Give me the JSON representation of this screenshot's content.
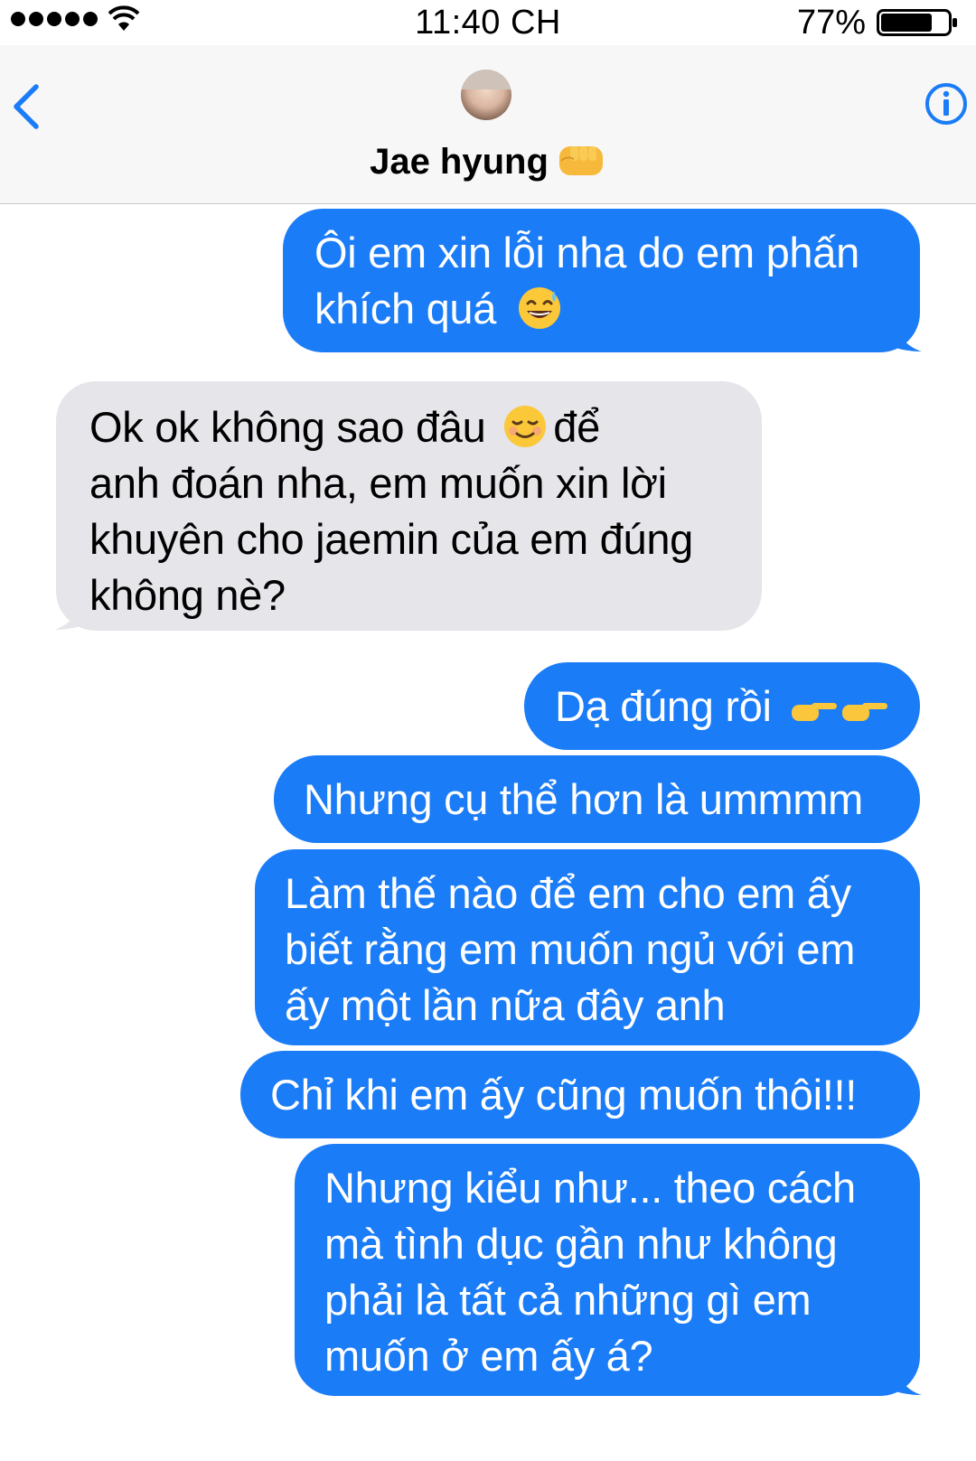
{
  "status_bar": {
    "time": "11:40 CH",
    "battery_percent": "77%",
    "signal_bars": 5,
    "battery_level": 0.77
  },
  "header": {
    "contact_name": "Jae hyung",
    "name_emoji": "fist-bump-emoji",
    "back_icon": "chevron-left-icon",
    "info_icon": "info-icon"
  },
  "colors": {
    "outgoing_bubble": "#1b7cf7",
    "incoming_bubble": "#e5e5ea",
    "accent": "#1b7cf7"
  },
  "messages": [
    {
      "direction": "outgoing",
      "lines": [
        "Ôi em xin lỗi nha do em phấn",
        "khích quá"
      ],
      "emoji": "sweat-smile-emoji"
    },
    {
      "direction": "incoming",
      "lines": [
        "Ok ok không sao đâu",
        "anh đoán nha, em muốn xin lời",
        "khuyên cho jaemin của em đúng",
        "không nè?"
      ],
      "inline_emoji": "relieved-smile-emoji",
      "after_emoji": "để"
    },
    {
      "direction": "outgoing",
      "lines": [
        "Dạ đúng rồi"
      ],
      "emoji": "pointing-hands-emoji"
    },
    {
      "direction": "outgoing",
      "lines": [
        "Nhưng cụ thể hơn là ummmm"
      ]
    },
    {
      "direction": "outgoing",
      "lines": [
        "Làm thế nào để em cho em ấy",
        "biết rằng em muốn ngủ với em",
        "ấy một lần nữa đây anh"
      ]
    },
    {
      "direction": "outgoing",
      "lines": [
        "Chỉ khi em ấy cũng muốn thôi!!!"
      ]
    },
    {
      "direction": "outgoing",
      "lines": [
        "Nhưng kiểu như... theo cách",
        "mà tình dục gần như không",
        "phải là tất cả những gì em",
        "muốn ở em ấy á?"
      ]
    }
  ]
}
